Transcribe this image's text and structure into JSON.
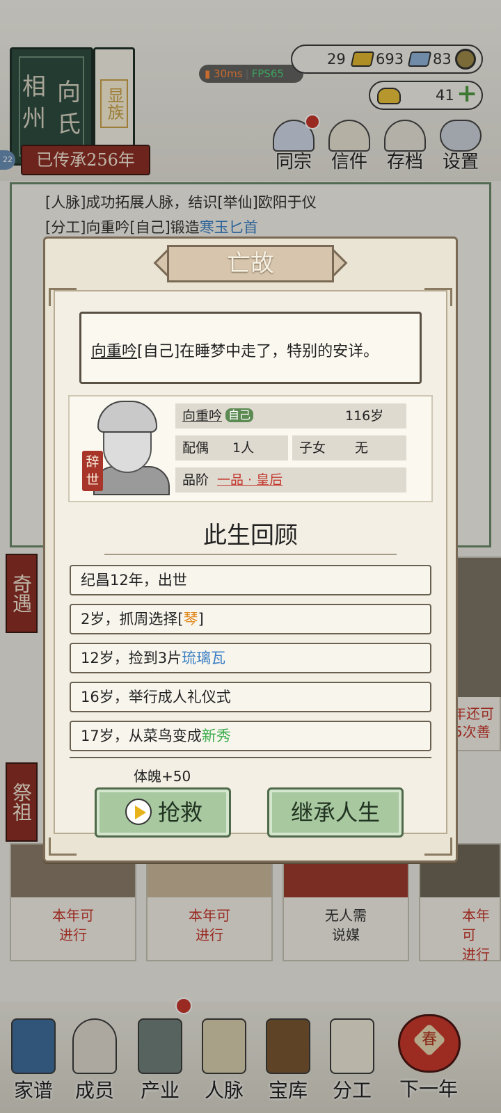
{
  "header": {
    "family_name_left": "相州",
    "family_name_right": "向氏",
    "clan_rank": "显族",
    "inheritance": "已传承256年",
    "level_badge": "22",
    "net": {
      "latency": "30ms",
      "fps": "FPS65"
    }
  },
  "resources": {
    "gold": "29",
    "silver": "693",
    "coins": "83",
    "ingots": "41"
  },
  "top_menu": [
    {
      "label": "同宗",
      "icon": "clan-book-icon"
    },
    {
      "label": "信件",
      "icon": "letter-icon"
    },
    {
      "label": "存档",
      "icon": "archive-icon"
    },
    {
      "label": "设置",
      "icon": "gear-icon"
    }
  ],
  "log": {
    "line1": "[人脉]成功拓展人脉，结识[举仙]欧阳于仪",
    "line2_prefix": "[分工]向重吟[自己]锻造",
    "line2_item": "寒玉匕首"
  },
  "side_tags": [
    "奇遇",
    "祭祖"
  ],
  "cards": [
    {
      "text": "本年可\n进行"
    },
    {
      "text": "本年可\n进行"
    },
    {
      "text": "无人需\n说媒"
    },
    {
      "text": "本年可\n进行"
    }
  ],
  "right_panel_text": [
    "年还可",
    "5次善"
  ],
  "nav": [
    {
      "label": "家谱",
      "icon": "family-tree-icon"
    },
    {
      "label": "成员",
      "icon": "member-icon"
    },
    {
      "label": "产业",
      "icon": "building-icon"
    },
    {
      "label": "人脉",
      "icon": "network-icon"
    },
    {
      "label": "宝库",
      "icon": "treasure-chest-icon"
    },
    {
      "label": "分工",
      "icon": "scroll-icon"
    },
    {
      "label": "下一年",
      "icon": "lantern-icon"
    }
  ],
  "next_year_glyph": "春",
  "modal": {
    "title": "亡故",
    "death_message_name": "向重吟",
    "death_message_rest": "[自己]在睡梦中走了，特别的安详。",
    "person": {
      "name": "向重吟",
      "self_tag": "自己",
      "age": "116岁",
      "spouse_label": "配偶",
      "spouse_value": "1人",
      "children_label": "子女",
      "children_value": "无",
      "rank_label": "品阶",
      "rank_value": "一品 · 皇后",
      "seal": "辞世"
    },
    "review_title": "此生回顾",
    "events": [
      {
        "prefix": "纪昌12年，出世",
        "hl": "",
        "suffix": ""
      },
      {
        "prefix": "2岁，抓周选择[",
        "hl": "琴",
        "suffix": "]"
      },
      {
        "prefix": "12岁，捡到3片",
        "hl": "琉璃瓦",
        "suffix": ""
      },
      {
        "prefix": "16岁，举行成人礼仪式",
        "hl": "",
        "suffix": ""
      },
      {
        "prefix": "17岁，从菜鸟变成",
        "hl": "新秀",
        "suffix": ""
      }
    ],
    "bonus": "体魄+50",
    "rescue_label": "抢救",
    "inherit_label": "继承人生"
  },
  "colors": {
    "accent_red": "#8c2f24",
    "accent_green": "#a8c8a0",
    "highlight_gold": "#e08a1e",
    "highlight_blue": "#3a7fc4",
    "highlight_green": "#3fae4f",
    "rank_red": "#c4362b"
  }
}
